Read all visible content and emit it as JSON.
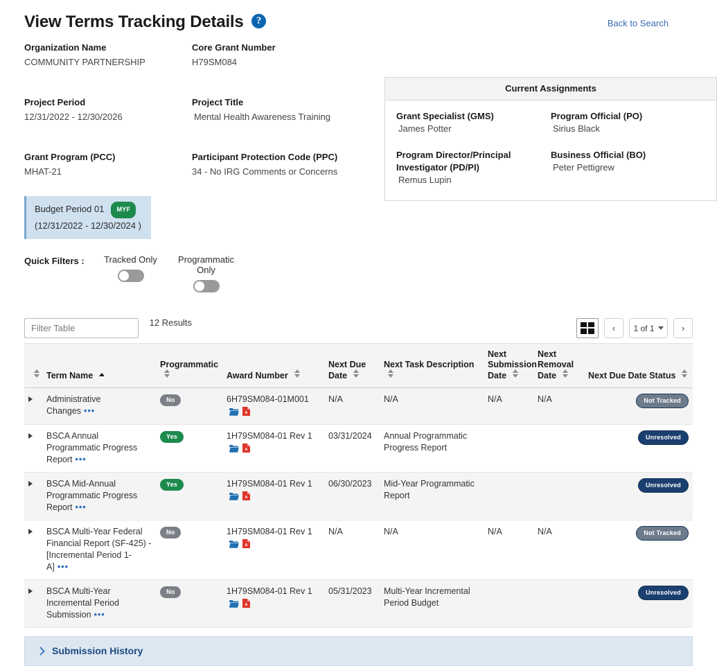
{
  "header": {
    "title": "View Terms Tracking Details",
    "help_icon": "help-circle-icon",
    "back_link": "Back to Search"
  },
  "details": {
    "rows": [
      [
        {
          "label": "Organization Name",
          "value": "COMMUNITY PARTNERSHIP"
        },
        {
          "label": "Core Grant Number",
          "value": "H79SM084"
        }
      ],
      [
        {
          "label": "Project Period",
          "value": "12/31/2022 - 12/30/2026"
        },
        {
          "label": "Project Title",
          "value": "Mental Health Awareness Training"
        }
      ],
      [
        {
          "label": "Grant Program (PCC)",
          "value": "MHAT-21"
        },
        {
          "label": "Participant Protection Code (PPC)",
          "value": "34 - No IRG Comments or Concerns"
        }
      ]
    ]
  },
  "assignments": {
    "title": "Current Assignments",
    "rows": [
      [
        {
          "label": "Grant Specialist (GMS)",
          "value": "James Potter"
        },
        {
          "label": "Program Official (PO)",
          "value": "Sirius Black"
        }
      ],
      [
        {
          "label": "Program Director/Principal Investigator (PD/PI)",
          "value": "Remus Lupin"
        },
        {
          "label": "Business Official (BO)",
          "value": "Peter Pettigrew"
        }
      ]
    ]
  },
  "budget_period": {
    "line1": "Budget Period 01",
    "badge": "MYF",
    "line2": "(12/31/2022 - 12/30/2024 )"
  },
  "quick_filters": {
    "label": "Quick Filters :",
    "items": [
      {
        "label": "Tracked Only",
        "on": false
      },
      {
        "label": "Programmatic Only",
        "on": false
      }
    ]
  },
  "table_bar": {
    "filter_placeholder": "Filter Table",
    "filter_value": "",
    "results": "12 Results",
    "grid_view_icon": "table-grid-icon",
    "prev_label": "‹",
    "next_label": "›",
    "page_indicator": "1 of 1"
  },
  "table": {
    "columns": [
      {
        "label": "Term Name",
        "sort": "asc"
      },
      {
        "label": "Programmatic",
        "sort": "none"
      },
      {
        "label": "Award Number",
        "sort": "none"
      },
      {
        "label": "Next Due Date",
        "sort": "none"
      },
      {
        "label": "Next Task Description",
        "sort": "none"
      },
      {
        "label": "Next Submission Date",
        "sort": "none"
      },
      {
        "label": "Next Removal Date",
        "sort": "none"
      },
      {
        "label": "Next Due Date Status",
        "sort": "none"
      }
    ],
    "rows": [
      {
        "term_name": "Administrative Changes",
        "programmatic": "No",
        "award_number": "6H79SM084-01M001",
        "next_due_date": "N/A",
        "next_task_description": "N/A",
        "next_submission_date": "N/A",
        "next_removal_date": "N/A",
        "status": "Not Tracked"
      },
      {
        "term_name": "BSCA Annual Programmatic Progress Report",
        "programmatic": "Yes",
        "award_number": "1H79SM084-01 Rev 1",
        "next_due_date": "03/31/2024",
        "next_task_description": "Annual Programmatic Progress Report",
        "next_submission_date": "",
        "next_removal_date": "",
        "status": "Unresolved"
      },
      {
        "term_name": "BSCA Mid-Annual Programmatic Progress Report",
        "programmatic": "Yes",
        "award_number": "1H79SM084-01 Rev 1",
        "next_due_date": "06/30/2023",
        "next_task_description": "Mid-Year Programmatic Report",
        "next_submission_date": "",
        "next_removal_date": "",
        "status": "Unresolved"
      },
      {
        "term_name": "BSCA Multi-Year Federal Financial Report (SF-425) - [Incremental Period 1-A]",
        "programmatic": "No",
        "award_number": "1H79SM084-01 Rev 1",
        "next_due_date": "N/A",
        "next_task_description": "N/A",
        "next_submission_date": "N/A",
        "next_removal_date": "N/A",
        "status": "Not Tracked"
      },
      {
        "term_name": "BSCA Multi-Year Incremental Period Submission",
        "programmatic": "No",
        "award_number": "1H79SM084-01 Rev 1",
        "next_due_date": "05/31/2023",
        "next_task_description": "Multi-Year Incremental Period Budget",
        "next_submission_date": "",
        "next_removal_date": "",
        "status": "Unresolved"
      }
    ],
    "row_menu_icon": "ellipsis-icon",
    "expander_icon": "expand-triangle-icon",
    "folder_icon": "folder-icon",
    "pdf_icon": "pdf-icon"
  },
  "submission_history": {
    "label": "Submission History",
    "chevron_icon": "chevron-right-icon"
  },
  "colors": {
    "accent_blue": "#1b4a80",
    "link_blue": "#3b6cb4",
    "green": "#1d8a4d",
    "gray_pill": "#7b7f86",
    "not_tracked": "#6e7b8b",
    "tab_bg": "#cfe0ef",
    "pdf_red": "#e0352b",
    "folder_blue": "#1f6fb2"
  }
}
